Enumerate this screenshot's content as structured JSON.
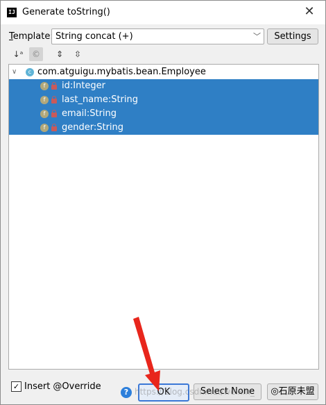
{
  "window": {
    "title": "Generate toString()",
    "app_icon_text": "IJ"
  },
  "template": {
    "label_mnemonic": "T",
    "label_rest": "emplate:",
    "value": "String concat (+)"
  },
  "buttons": {
    "settings": "Settings",
    "ok": "OK",
    "select_none": "Select None",
    "cancel_overlay": "◎石原未盟"
  },
  "tree": {
    "root": {
      "label": "com.atguigu.mybatis.bean.Employee",
      "icon": "class-icon"
    },
    "fields": [
      {
        "label": "id:Integer"
      },
      {
        "label": "last_name:String"
      },
      {
        "label": "email:String"
      },
      {
        "label": "gender:String"
      }
    ]
  },
  "footer": {
    "insert_override": "Insert @Override",
    "checked": true
  },
  "watermark": "https://blog.csdn.net/weixin_",
  "colors": {
    "selection": "#2f7fc5",
    "arrow": "#e8261c"
  }
}
